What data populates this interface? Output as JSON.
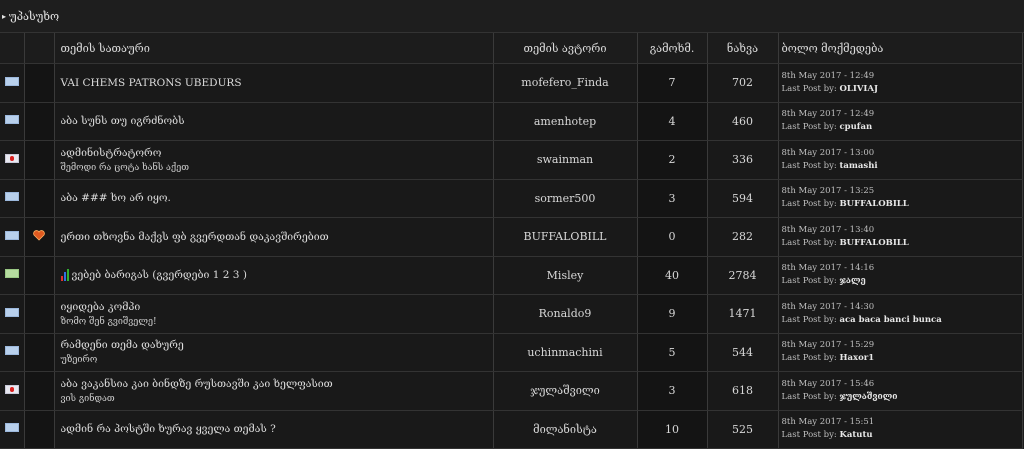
{
  "header": {
    "forum_label": "უპასუხო"
  },
  "columns": {
    "title": "თემის სათაური",
    "author": "თემის ავტორი",
    "replies": "გამოხმ.",
    "views": "ნახვა",
    "last_post": "ბოლო მოქმედება"
  },
  "last_post_prefix": "Last Post by:",
  "rows": [
    {
      "icon": "envelope",
      "title": "VAI CHEMS PATRONS UBEDURS",
      "subtitle": "",
      "author": "mofefero_Finda",
      "replies": "7",
      "views": "702",
      "date": "8th May 2017 - 12:49",
      "last_by": "OLIVIAJ"
    },
    {
      "icon": "envelope",
      "title": "აბა სუნს თუ იგრძნობს",
      "subtitle": "",
      "author": "amenhotep",
      "replies": "4",
      "views": "460",
      "date": "8th May 2017 - 12:49",
      "last_by": "cpufan"
    },
    {
      "icon": "envelope-hot",
      "title": "ადმინისტრატორო",
      "subtitle": "შემოდი რა ცოტა ხანს აქეთ",
      "author": "swainman",
      "replies": "2",
      "views": "336",
      "date": "8th May 2017 - 13:00",
      "last_by": "tamashi"
    },
    {
      "icon": "envelope",
      "title": "აბა ### ხო არ იყო.",
      "subtitle": "",
      "author": "sormer500",
      "replies": "3",
      "views": "594",
      "date": "8th May 2017 - 13:25",
      "last_by": "BUFFALOBILL"
    },
    {
      "icon": "envelope",
      "topic_icon": "heart",
      "title": "ერთი თხოვნა მაქვს ფბ გვერდთან დაკავშირებით",
      "subtitle": "",
      "author": "BUFFALOBILL",
      "replies": "0",
      "views": "282",
      "date": "8th May 2017 - 13:40",
      "last_by": "BUFFALOBILL"
    },
    {
      "icon": "envelope-green",
      "poll": true,
      "title": "ვებებ ბარიგას (გვერდები 1 2 3 )",
      "subtitle": "",
      "author": "Misley",
      "replies": "40",
      "views": "2784",
      "date": "8th May 2017 - 14:16",
      "last_by": "ჯალე"
    },
    {
      "icon": "envelope",
      "title": "იყიდება კომპი",
      "subtitle": "ზომო შენ გვიშველე!",
      "author": "Ronaldo9",
      "replies": "9",
      "views": "1471",
      "date": "8th May 2017 - 14:30",
      "last_by": "aca baca banci bunca"
    },
    {
      "icon": "envelope",
      "title": "რამდენი თემა დახურე",
      "subtitle": "უზეირო",
      "author": "uchinmachini",
      "replies": "5",
      "views": "544",
      "date": "8th May 2017 - 15:29",
      "last_by": "Haxor1"
    },
    {
      "icon": "envelope-hot",
      "title": "აბა ვაკანსია კაი ბინდზე რუსთავში კაი ხელფასით",
      "subtitle": "ვის გინდათ",
      "author": "ჯულაშვილი",
      "replies": "3",
      "views": "618",
      "date": "8th May 2017 - 15:46",
      "last_by": "ჯულაშვილი"
    },
    {
      "icon": "envelope",
      "title": "ადმინ რა პოსტში ხურავ ყველა თემას ?",
      "subtitle": "",
      "author": "მილანისტა",
      "replies": "10",
      "views": "525",
      "date": "8th May 2017 - 15:51",
      "last_by": "Katutu"
    }
  ]
}
